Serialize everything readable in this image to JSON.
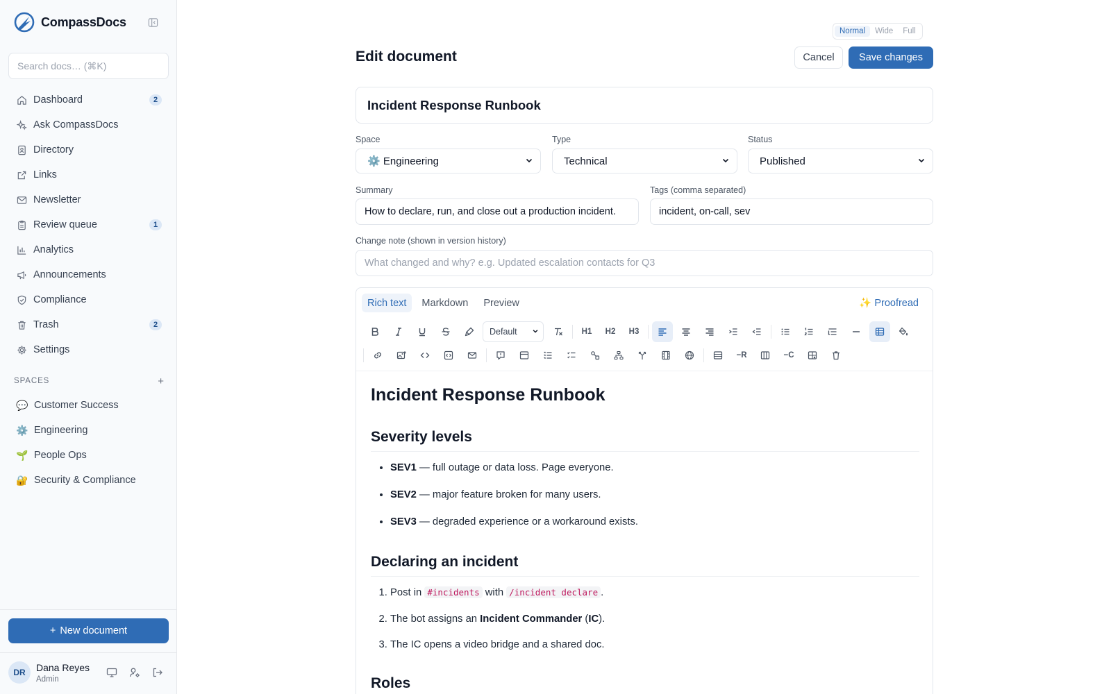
{
  "app": {
    "name": "CompassDocs"
  },
  "search": {
    "placeholder": "Search docs… (⌘K)"
  },
  "nav": [
    {
      "label": "Dashboard",
      "icon": "home-icon",
      "badge": "2"
    },
    {
      "label": "Ask CompassDocs",
      "icon": "sparkles-icon",
      "badge": null
    },
    {
      "label": "Directory",
      "icon": "contact-book-icon",
      "badge": null
    },
    {
      "label": "Links",
      "icon": "external-link-icon",
      "badge": null
    },
    {
      "label": "Newsletter",
      "icon": "mail-icon",
      "badge": null
    },
    {
      "label": "Review queue",
      "icon": "clipboard-icon",
      "badge": "1"
    },
    {
      "label": "Analytics",
      "icon": "bar-chart-icon",
      "badge": null
    },
    {
      "label": "Announcements",
      "icon": "megaphone-icon",
      "badge": null
    },
    {
      "label": "Compliance",
      "icon": "shield-check-icon",
      "badge": null
    },
    {
      "label": "Trash",
      "icon": "trash-icon",
      "badge": "2"
    },
    {
      "label": "Settings",
      "icon": "gear-icon",
      "badge": null
    }
  ],
  "spaces": {
    "title": "SPACES",
    "add": "+",
    "items": [
      {
        "emoji": "💬",
        "label": "Customer Success"
      },
      {
        "emoji": "⚙️",
        "label": "Engineering"
      },
      {
        "emoji": "🌱",
        "label": "People Ops"
      },
      {
        "emoji": "🔐",
        "label": "Security & Compliance"
      }
    ]
  },
  "new_doc": {
    "plus": "+",
    "label": "New document"
  },
  "user": {
    "initials": "DR",
    "name": "Dana Reyes",
    "role": "Admin"
  },
  "width_toggle": {
    "options": [
      "Normal",
      "Wide",
      "Full"
    ],
    "selected": "Normal"
  },
  "header": {
    "title": "Edit document",
    "cancel": "Cancel",
    "save": "Save changes"
  },
  "doc": {
    "title": "Incident Response Runbook",
    "space_label": "Space",
    "space_value": "⚙️ Engineering",
    "type_label": "Type",
    "type_value": "Technical",
    "status_label": "Status",
    "status_value": "Published",
    "summary_label": "Summary",
    "summary_value": "How to declare, run, and close out a production incident.",
    "tags_label": "Tags (comma separated)",
    "tags_value": "incident, on-call, sev",
    "change_note_label": "Change note (shown in version history)",
    "change_note_placeholder": "What changed and why? e.g. Updated escalation contacts for Q3"
  },
  "editor": {
    "tabs": [
      "Rich text",
      "Markdown",
      "Preview"
    ],
    "active_tab": "Rich text",
    "proofread": "✨ Proofread",
    "style_select": "Default",
    "h1": "H1",
    "h2": "H2",
    "h3": "H3",
    "remove_row": "−R",
    "remove_col": "−C"
  },
  "content": {
    "h1": "Incident Response Runbook",
    "sev_heading": "Severity levels",
    "sev_items": [
      {
        "term": "SEV1",
        "text": " — full outage or data loss. Page everyone."
      },
      {
        "term": "SEV2",
        "text": " — major feature broken for many users."
      },
      {
        "term": "SEV3",
        "text": " — degraded experience or a workaround exists."
      }
    ],
    "declare_heading": "Declaring an incident",
    "step1": {
      "pre": "Post in ",
      "code1": "#incidents",
      "mid": " with ",
      "code2": "/incident declare",
      "post": "."
    },
    "step2": {
      "pre": "The bot assigns an ",
      "strong1": "Incident Commander",
      "mid": " (",
      "strong2": "IC",
      "post": ")."
    },
    "step3": "The IC opens a video bridge and a shared doc.",
    "roles_heading": "Roles"
  }
}
